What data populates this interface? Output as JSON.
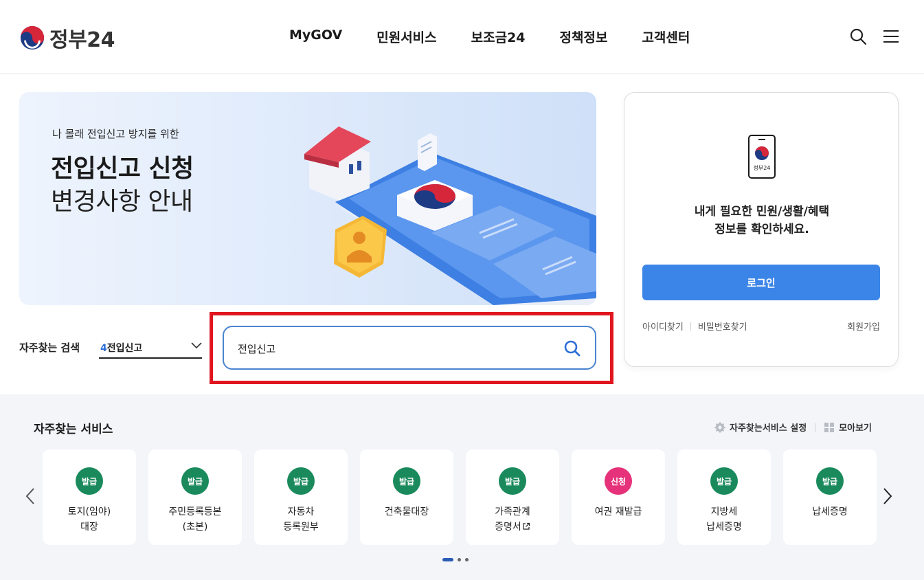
{
  "header": {
    "logo_text": "정부24",
    "nav": [
      "MyGOV",
      "민원서비스",
      "보조금24",
      "정책정보",
      "고객센터"
    ],
    "icons": [
      "search-icon",
      "hamburger-menu-icon"
    ]
  },
  "banner": {
    "subtitle": "나 몰래 전입신고 방지를 위한",
    "title_line1": "전입신고 신청",
    "title_line2": "변경사항 안내"
  },
  "login": {
    "phone_label": "정부24",
    "message_line1": "내게 필요한 민원/생활/혜택",
    "message_line2": "정보를 확인하세요.",
    "login_button": "로그인",
    "find_id": "아이디찾기",
    "find_password": "비밀번호찾기",
    "signup": "회원가입"
  },
  "frequent_search": {
    "label": "자주찾는 검색",
    "selected_number": "4",
    "selected_text": "전입신고",
    "search_value": "전입신고"
  },
  "services": {
    "title": "자주찾는 서비스",
    "settings_label": "자주찾는서비스 설정",
    "view_all_label": "모아보기",
    "items": [
      {
        "badge": "발급",
        "line1": "토지(임야)",
        "line2": "대장"
      },
      {
        "badge": "발급",
        "line1": "주민등록등본",
        "line2": "(초본)"
      },
      {
        "badge": "발급",
        "line1": "자동차",
        "line2": "등록원부"
      },
      {
        "badge": "발급",
        "line1": "건축물대장",
        "line2": ""
      },
      {
        "badge": "발급",
        "line1": "가족관계",
        "line2": "증명서"
      },
      {
        "badge": "신청",
        "line1": "여권 재발급",
        "line2": ""
      },
      {
        "badge": "발급",
        "line1": "지방세",
        "line2": "납세증명"
      },
      {
        "badge": "발급",
        "line1": "납세증명",
        "line2": ""
      }
    ],
    "pagination_active": 1,
    "pagination_total": 3
  },
  "colors": {
    "primary_blue": "#3c85e8",
    "badge_green": "#1a8a5c",
    "badge_pink": "#e6327a",
    "highlight_red": "#e0161f"
  }
}
